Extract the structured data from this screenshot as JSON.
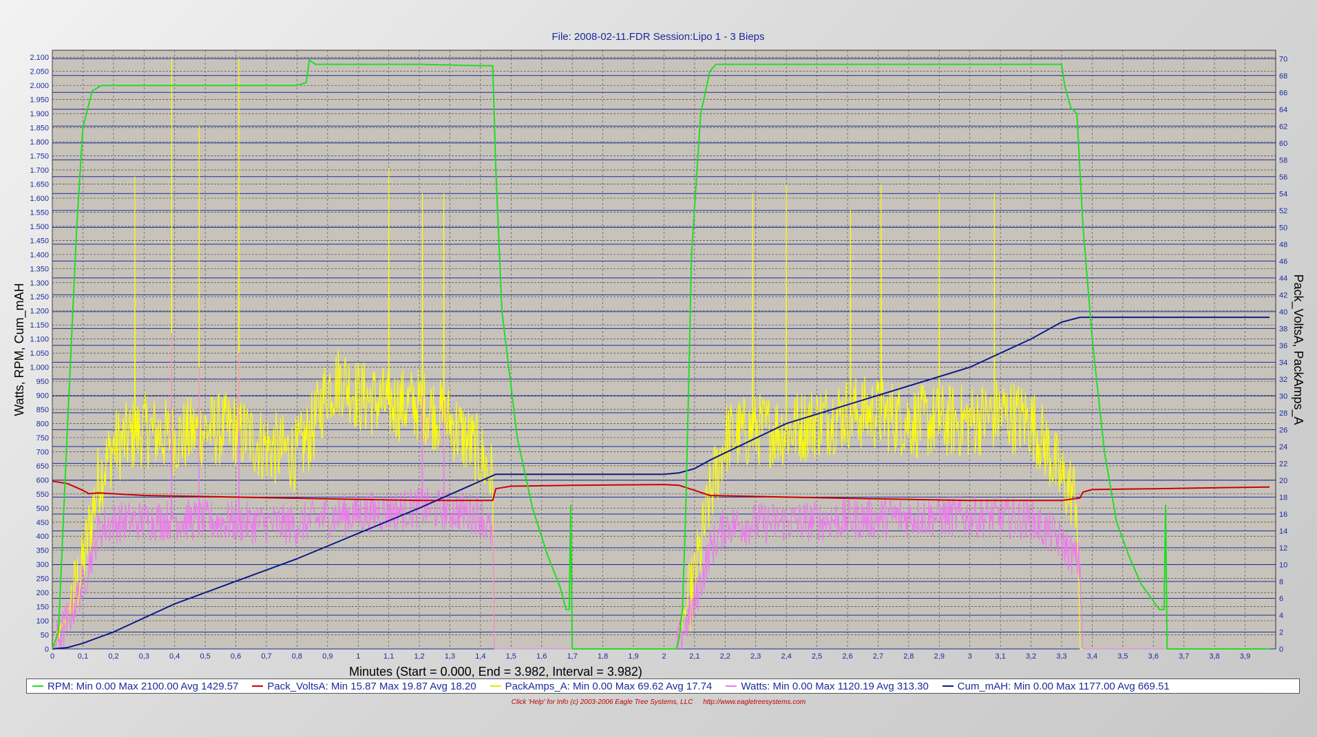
{
  "chart_data": {
    "type": "line",
    "title": "File: 2008-02-11.FDR   Session:Lipo 1 - 3 Bieps",
    "xlabel": "Minutes (Start = 0.000,  End = 3.982,  Interval =  3.982)",
    "ylabel_left": "Watts, RPM, Cum_mAH",
    "ylabel_right": "Pack_VoltsA, PackAmps_A",
    "xlim": [
      0,
      4.0
    ],
    "ylim_left": [
      0,
      2125
    ],
    "ylim_right": [
      0,
      71
    ],
    "x_ticks": [
      "0",
      "0,1",
      "0,2",
      "0,3",
      "0,4",
      "0,5",
      "0,6",
      "0,7",
      "0,8",
      "0,9",
      "1",
      "1,1",
      "1,2",
      "1,3",
      "1,4",
      "1,5",
      "1,6",
      "1,7",
      "1,8",
      "1,9",
      "2",
      "2,1",
      "2,2",
      "2,3",
      "2,4",
      "2,5",
      "2,6",
      "2,7",
      "2,8",
      "2,9",
      "3",
      "3,1",
      "3,2",
      "3,3",
      "3,4",
      "3,5",
      "3,6",
      "3,7",
      "3,8",
      "3,9"
    ],
    "y_ticks_left": [
      "0",
      "50",
      "100",
      "150",
      "200",
      "250",
      "300",
      "350",
      "400",
      "450",
      "500",
      "550",
      "600",
      "650",
      "700",
      "750",
      "800",
      "850",
      "900",
      "950",
      "1.000",
      "1.050",
      "1.100",
      "1.150",
      "1.200",
      "1.250",
      "1.300",
      "1.350",
      "1.400",
      "1.450",
      "1.500",
      "1.550",
      "1.600",
      "1.650",
      "1.700",
      "1.750",
      "1.800",
      "1.850",
      "1.900",
      "1.950",
      "2.000",
      "2.050",
      "2.100"
    ],
    "y_ticks_right": [
      "0",
      "2",
      "4",
      "6",
      "8",
      "10",
      "12",
      "14",
      "16",
      "18",
      "20",
      "22",
      "24",
      "26",
      "28",
      "30",
      "32",
      "34",
      "36",
      "38",
      "40",
      "42",
      "44",
      "46",
      "48",
      "50",
      "52",
      "54",
      "56",
      "58",
      "60",
      "62",
      "64",
      "66",
      "68",
      "70"
    ],
    "grid": true,
    "series": [
      {
        "name": "RPM",
        "axis": "left",
        "color": "#22dd22",
        "x": [
          0,
          0.02,
          0.05,
          0.08,
          0.1,
          0.13,
          0.16,
          0.3,
          0.5,
          0.8,
          0.83,
          0.84,
          0.86,
          0.9,
          1.0,
          1.2,
          1.4,
          1.44,
          1.45,
          1.47,
          1.52,
          1.57,
          1.62,
          1.66,
          1.68,
          1.69,
          1.695,
          1.7,
          1.71,
          1.72,
          2.04,
          2.05,
          2.06,
          2.07,
          2.08,
          2.09,
          2.12,
          2.15,
          2.17,
          2.3,
          2.5,
          2.7,
          2.9,
          3.1,
          3.3,
          3.31,
          3.33,
          3.35,
          3.37,
          3.4,
          3.44,
          3.48,
          3.52,
          3.56,
          3.6,
          3.62,
          3.635,
          3.64,
          3.645,
          3.65,
          3.66,
          3.7,
          3.98
        ],
        "values": [
          0,
          60,
          800,
          1500,
          1850,
          1980,
          2000,
          2000,
          2000,
          2000,
          2010,
          2090,
          2075,
          2075,
          2075,
          2075,
          2070,
          2070,
          1700,
          1200,
          750,
          500,
          330,
          220,
          140,
          140,
          510,
          0,
          0,
          0,
          0,
          40,
          140,
          450,
          900,
          1400,
          1900,
          2050,
          2075,
          2075,
          2075,
          2075,
          2075,
          2075,
          2075,
          2000,
          1920,
          1900,
          1500,
          1100,
          700,
          450,
          330,
          230,
          170,
          140,
          140,
          510,
          0,
          0,
          0,
          0,
          0
        ]
      },
      {
        "name": "Pack_VoltsA",
        "axis": "right",
        "color": "#cc0000",
        "x": [
          0,
          0.05,
          0.1,
          0.12,
          0.15,
          0.3,
          0.6,
          0.9,
          1.2,
          1.44,
          1.45,
          1.5,
          1.7,
          2.0,
          2.05,
          2.1,
          2.15,
          2.4,
          2.7,
          3.0,
          3.3,
          3.36,
          3.37,
          3.4,
          3.6,
          3.98
        ],
        "values": [
          19.9,
          19.6,
          18.8,
          18.4,
          18.5,
          18.2,
          18.0,
          17.8,
          17.6,
          17.6,
          19.0,
          19.3,
          19.4,
          19.5,
          19.4,
          18.8,
          18.2,
          18.0,
          17.8,
          17.6,
          17.6,
          17.9,
          18.6,
          18.9,
          19.0,
          19.2
        ]
      },
      {
        "name": "PackAmps_A",
        "axis": "right",
        "color": "#ffff00",
        "noise": true,
        "x": [
          0,
          0.05,
          0.1,
          0.15,
          0.2,
          0.3,
          0.4,
          0.5,
          0.6,
          0.7,
          0.8,
          0.85,
          0.9,
          0.95,
          1.0,
          1.1,
          1.2,
          1.3,
          1.4,
          1.44,
          1.445,
          1.7,
          2.04,
          2.05,
          2.1,
          2.15,
          2.2,
          2.3,
          2.4,
          2.5,
          2.6,
          2.7,
          2.8,
          2.9,
          3.0,
          3.1,
          3.2,
          3.25,
          3.3,
          3.35,
          3.36,
          3.37,
          3.98
        ],
        "values": [
          0,
          4,
          10,
          20,
          24,
          26,
          25,
          26,
          26,
          24,
          23,
          26,
          31,
          32,
          30,
          29,
          29,
          27,
          23,
          20,
          0,
          0,
          0,
          2,
          8,
          18,
          25,
          26,
          26,
          27,
          28,
          28,
          27,
          27,
          27,
          28,
          27,
          24,
          20,
          18,
          0,
          0,
          0
        ],
        "spikes_x": [
          0.27,
          0.39,
          0.48,
          0.61,
          1.1,
          1.21,
          1.28,
          2.29,
          2.4,
          2.61,
          2.71,
          2.9,
          3.08
        ],
        "spikes": [
          56,
          70,
          62,
          70,
          57,
          54,
          54,
          54,
          55,
          52,
          55,
          54,
          54
        ]
      },
      {
        "name": "Watts",
        "axis": "left",
        "color": "#ee77ee",
        "noise": true,
        "x": [
          0,
          0.05,
          0.1,
          0.15,
          0.2,
          0.4,
          0.6,
          0.8,
          0.9,
          1.0,
          1.2,
          1.4,
          1.44,
          1.445,
          1.7,
          2.04,
          2.05,
          2.1,
          2.15,
          2.2,
          2.4,
          2.6,
          2.8,
          3.0,
          3.2,
          3.3,
          3.36,
          3.37,
          3.98
        ],
        "values": [
          0,
          100,
          230,
          420,
          450,
          460,
          450,
          440,
          470,
          480,
          500,
          480,
          400,
          0,
          0,
          0,
          30,
          160,
          350,
          440,
          450,
          460,
          470,
          470,
          460,
          380,
          300,
          0,
          0
        ],
        "spikes_x": [
          0.39,
          0.48,
          0.61,
          1.21,
          1.28
        ],
        "spikes": [
          1120,
          1000,
          1050,
          900,
          880
        ]
      },
      {
        "name": "Cum_mAH",
        "axis": "left",
        "color": "#0c1a88",
        "x": [
          0,
          0.05,
          0.1,
          0.2,
          0.4,
          0.6,
          0.8,
          1.0,
          1.2,
          1.44,
          1.45,
          1.7,
          2.0,
          2.05,
          2.1,
          2.15,
          2.4,
          2.7,
          3.0,
          3.2,
          3.3,
          3.36,
          3.98
        ],
        "values": [
          0,
          5,
          20,
          60,
          160,
          240,
          320,
          410,
          500,
          615,
          620,
          620,
          620,
          625,
          640,
          670,
          800,
          900,
          1000,
          1100,
          1160,
          1177,
          1177
        ]
      }
    ],
    "legend": [
      {
        "label": "RPM:  Min 0.00    Max 2100.00    Avg 1429.57",
        "color": "#22dd22"
      },
      {
        "label": "Pack_VoltsA:  Min 15.87    Max 19.87    Avg 18.20",
        "color": "#cc0000"
      },
      {
        "label": "PackAmps_A:  Min 0.00    Max 69.62    Avg 17.74",
        "color": "#ffff00"
      },
      {
        "label": "Watts:  Min 0.00    Max 1120.19    Avg 313.30",
        "color": "#ee77ee"
      },
      {
        "label": "Cum_mAH:  Min 0.00    Max 1177.00    Avg 669.51",
        "color": "#0c1a88"
      }
    ],
    "legend_position": "bottom"
  },
  "footer": {
    "help": "Click 'Help' for Info  (c) 2003-2006 Eagle Tree Systems, LLC",
    "url": "http://www.eagletreesystems.com"
  }
}
